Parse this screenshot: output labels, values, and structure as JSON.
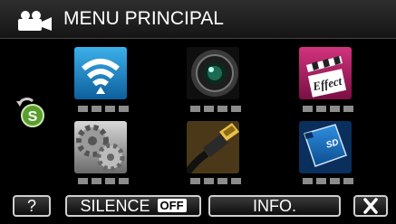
{
  "header": {
    "title": "MENU PRINCIPAL",
    "icon": "movie-camera-icon"
  },
  "side": {
    "icon": "smartphone-connect-icon",
    "badge": "S"
  },
  "menu_tiles": [
    {
      "icon": "wifi-icon"
    },
    {
      "icon": "camera-lens-icon"
    },
    {
      "icon": "effect-clapper-icon"
    },
    {
      "icon": "gears-settings-icon"
    },
    {
      "icon": "hdmi-cable-icon"
    },
    {
      "icon": "sd-card-icon"
    }
  ],
  "footer": {
    "help_label": "?",
    "silence_label": "SILENCE",
    "silence_state": "OFF",
    "info_label": "INFO.",
    "close_icon": "close-x-icon"
  },
  "colors": {
    "wifi_blue": "#1d8fd0",
    "effect_pink": "#a0185a",
    "sd_blue": "#1a6fc0",
    "side_green": "#5a9e2e"
  }
}
